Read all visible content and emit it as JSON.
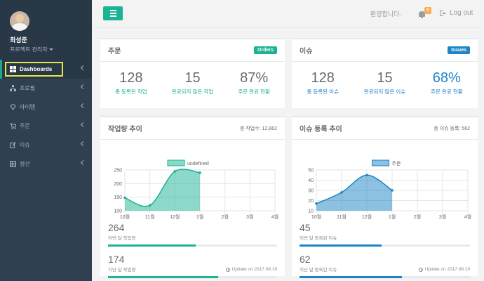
{
  "profile": {
    "name": "최성준",
    "role": "프로젝트 관리자"
  },
  "sidebar": {
    "items": [
      {
        "label": "Dashboards",
        "icon": "dashboard-icon",
        "active": true
      },
      {
        "label": "프로필",
        "icon": "sitemap-icon"
      },
      {
        "label": "아이템",
        "icon": "diamond-icon"
      },
      {
        "label": "주문",
        "icon": "cart-icon"
      },
      {
        "label": "이슈",
        "icon": "edit-icon"
      },
      {
        "label": "정산",
        "icon": "table-icon"
      }
    ]
  },
  "topbar": {
    "welcome": "환영합니다.",
    "notify_count": "8",
    "logout": "Log out"
  },
  "orders": {
    "title": "주문",
    "badge": "Orders",
    "stats": [
      {
        "value": "128",
        "label": "총 등록된 작업"
      },
      {
        "value": "15",
        "label": "완료되지 않은 작업"
      },
      {
        "value": "87%",
        "label": "주문 완료 현황"
      }
    ]
  },
  "issues": {
    "title": "이슈",
    "badge": "Issues",
    "stats": [
      {
        "value": "128",
        "label": "총 등록된 이슈"
      },
      {
        "value": "15",
        "label": "완료되지 않은 이슈"
      },
      {
        "value": "68%",
        "label": "주문 완료 현황"
      }
    ]
  },
  "work_trend": {
    "title": "작업량 추이",
    "subtitle": "총 작업수: 12,862",
    "summary": [
      {
        "value": "264",
        "label": "이번 달 작업량",
        "progress": 0.52
      },
      {
        "value": "174",
        "label": "지난 달 작업량",
        "progress": 0.65
      }
    ],
    "update": "Update on 2017.08.19"
  },
  "issue_trend": {
    "title": "이슈 등록 추이",
    "subtitle": "총 이슈 등록: 562",
    "summary": [
      {
        "value": "45",
        "label": "이번 달 등록된 이슈",
        "progress": 0.48
      },
      {
        "value": "62",
        "label": "지난 달 등록된 이슈",
        "progress": 0.6
      }
    ],
    "update": "Update on 2017.08.19"
  },
  "colors": {
    "green": "#1ab394",
    "blue": "#1c84c6",
    "sidebar": "#2f4050"
  },
  "chart_data": [
    {
      "type": "area",
      "categories": [
        "10월",
        "11월",
        "12월",
        "1월",
        "2월",
        "3월",
        "4월"
      ],
      "series": [
        {
          "name": "undefined",
          "values": [
            148,
            120,
            245,
            240
          ]
        }
      ],
      "ylim": [
        100,
        250
      ],
      "yticks": [
        100,
        150,
        200,
        250
      ],
      "color": "#1ab394",
      "grid": true,
      "legend": "top"
    },
    {
      "type": "area",
      "categories": [
        "10월",
        "11월",
        "12월",
        "1월",
        "2월",
        "3월",
        "4월"
      ],
      "series": [
        {
          "name": "주문",
          "values": [
            17,
            28,
            45,
            30
          ]
        }
      ],
      "ylim": [
        10,
        50
      ],
      "yticks": [
        10,
        20,
        30,
        40,
        50
      ],
      "color": "#1c84c6",
      "grid": true,
      "legend": "top"
    }
  ]
}
